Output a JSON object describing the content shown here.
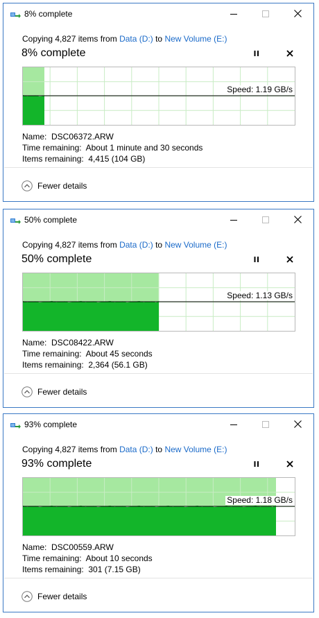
{
  "dialogs": [
    {
      "title": "8% complete",
      "copy_prefix": "Copying 4,827 items from ",
      "source": "Data (D:)",
      "to_word": " to ",
      "destination": "New Volume (E:)",
      "progress_heading": "8% complete",
      "progress": 0.08,
      "speed_label": "Speed: 1.19 GB/s",
      "name_label": "Name:",
      "name_value": "DSC06372.ARW",
      "time_label": "Time remaining:",
      "time_value": "About 1 minute and 30 seconds",
      "items_label": "Items remaining:",
      "items_value": "4,415 (104 GB)",
      "fewer_details": "Fewer details"
    },
    {
      "title": "50% complete",
      "copy_prefix": "Copying 4,827 items from ",
      "source": "Data (D:)",
      "to_word": " to ",
      "destination": "New Volume (E:)",
      "progress_heading": "50% complete",
      "progress": 0.5,
      "speed_label": "Speed: 1.13 GB/s",
      "name_label": "Name:",
      "name_value": "DSC08422.ARW",
      "time_label": "Time remaining:",
      "time_value": "About 45 seconds",
      "items_label": "Items remaining:",
      "items_value": "2,364 (56.1 GB)",
      "fewer_details": "Fewer details"
    },
    {
      "title": "93% complete",
      "copy_prefix": "Copying 4,827 items from ",
      "source": "Data (D:)",
      "to_word": " to ",
      "destination": "New Volume (E:)",
      "progress_heading": "93% complete",
      "progress": 0.93,
      "speed_label": "Speed: 1.18 GB/s",
      "name_label": "Name:",
      "name_value": "DSC00559.ARW",
      "time_label": "Time remaining:",
      "time_value": "About 10 seconds",
      "items_label": "Items remaining:",
      "items_value": "301 (7.15 GB)",
      "fewer_details": "Fewer details"
    }
  ],
  "colors": {
    "progress_fill": "#a6e8a0",
    "speed_fill": "#13b52a",
    "grid_line": "#c8ecc4",
    "link": "#1a6ac9",
    "window_border": "#3a78c4"
  },
  "icons": {
    "title": "copy-files-icon",
    "pause": "pause-icon",
    "cancel": "cancel-icon",
    "expand": "chevron-up-circle-icon",
    "minimize": "minimize-icon",
    "maximize": "maximize-icon",
    "close": "close-icon"
  }
}
